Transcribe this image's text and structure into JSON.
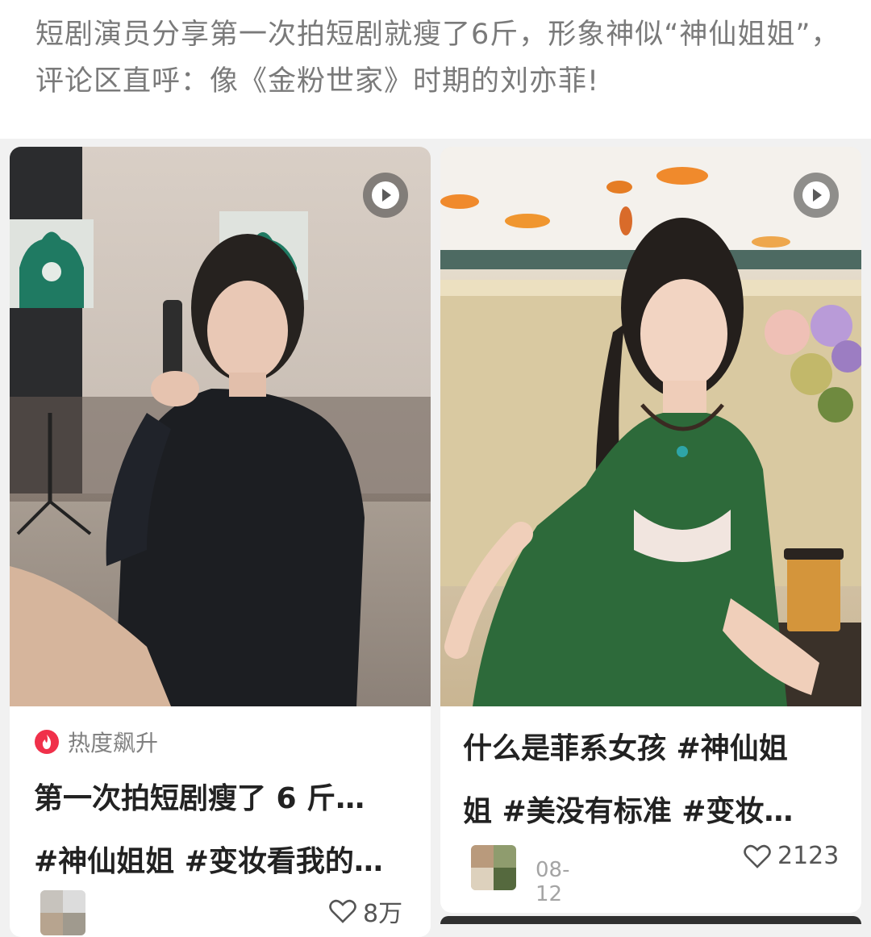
{
  "headline": "短剧演员分享第一次拍短剧就瘦了6斤，形象神似“神仙姐姐”，评论区直呼：像《金粉世家》时期的刘亦菲!",
  "cards": [
    {
      "badge": "热度飙升",
      "title_lines": [
        "第一次拍短剧瘦了 6 斤…",
        "#神仙姐姐 #变妆看我的…"
      ],
      "likes": "8万",
      "icons": {
        "play": "play-icon",
        "badge": "flame-icon",
        "like": "heart-icon"
      }
    },
    {
      "title_lines": [
        "什么是菲系女孩 #神仙姐",
        "姐 #美没有标准 #变妆…"
      ],
      "date": "08-12",
      "likes": "2123",
      "icons": {
        "play": "play-icon",
        "like": "heart-icon"
      }
    }
  ],
  "colors": {
    "badge_red": "#f0304a",
    "text_dark": "#222222",
    "text_gray": "#7a7a7a"
  }
}
